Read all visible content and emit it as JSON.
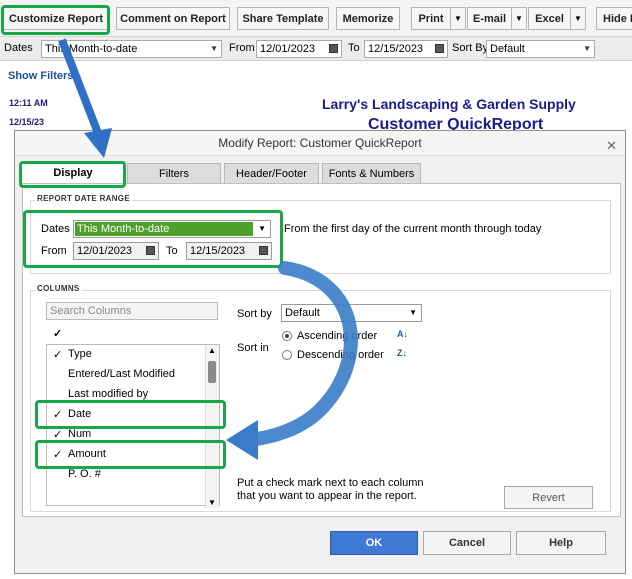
{
  "toolbar": {
    "customize_report": "Customize Report",
    "comment_on_report": "Comment on Report",
    "share_template": "Share Template",
    "memorize": "Memorize",
    "print": "Print",
    "email": "E-mail",
    "excel": "Excel",
    "hide": "Hide H"
  },
  "filter_bar": {
    "dates_label": "Dates",
    "dates_value": "This Month-to-date",
    "from_label": "From",
    "from_value": "12/01/2023",
    "to_label": "To",
    "to_value": "12/15/2023",
    "sort_by_label": "Sort By",
    "sort_by_value": "Default"
  },
  "show_filters": "Show Filters",
  "report_meta": {
    "time": "12:11 AM",
    "date": "12/15/23"
  },
  "report_header": {
    "company": "Larry's Landscaping & Garden Supply",
    "title": "Customer QuickReport"
  },
  "dialog": {
    "title": "Modify Report: Customer QuickReport",
    "tabs": [
      "Display",
      "Filters",
      "Header/Footer",
      "Fonts & Numbers"
    ],
    "report_date_range": {
      "title": "REPORT DATE RANGE",
      "dates_label": "Dates",
      "dates_value": "This Month-to-date",
      "description": "From the first day of the current month through today",
      "from_label": "From",
      "from_value": "12/01/2023",
      "to_label": "To",
      "to_value": "12/15/2023"
    },
    "columns": {
      "title": "COLUMNS",
      "search_placeholder": "Search Columns",
      "items": [
        {
          "checked": "✓",
          "label": "Type"
        },
        {
          "checked": "",
          "label": "Entered/Last Modified"
        },
        {
          "checked": "",
          "label": "Last modified by"
        },
        {
          "checked": "✓",
          "label": "Date"
        },
        {
          "checked": "✓",
          "label": "Num"
        },
        {
          "checked": "✓",
          "label": "Amount"
        },
        {
          "checked": "",
          "label": "P. O. #"
        }
      ],
      "header_check": "✓",
      "sort_by_label": "Sort by",
      "sort_by_value": "Default",
      "sort_in_label": "Sort in",
      "ascending": "Ascending order",
      "descending": "Descending order",
      "hint_line1": "Put a check mark next to each column",
      "hint_line2": "that you want to appear in the report."
    },
    "buttons": {
      "revert": "Revert",
      "ok": "OK",
      "cancel": "Cancel",
      "help": "Help"
    }
  },
  "colors": {
    "highlight": "#18a648",
    "arrow": "#3a7cc8",
    "accent": "#3f79d4",
    "dates_field": "#4fa02b"
  }
}
